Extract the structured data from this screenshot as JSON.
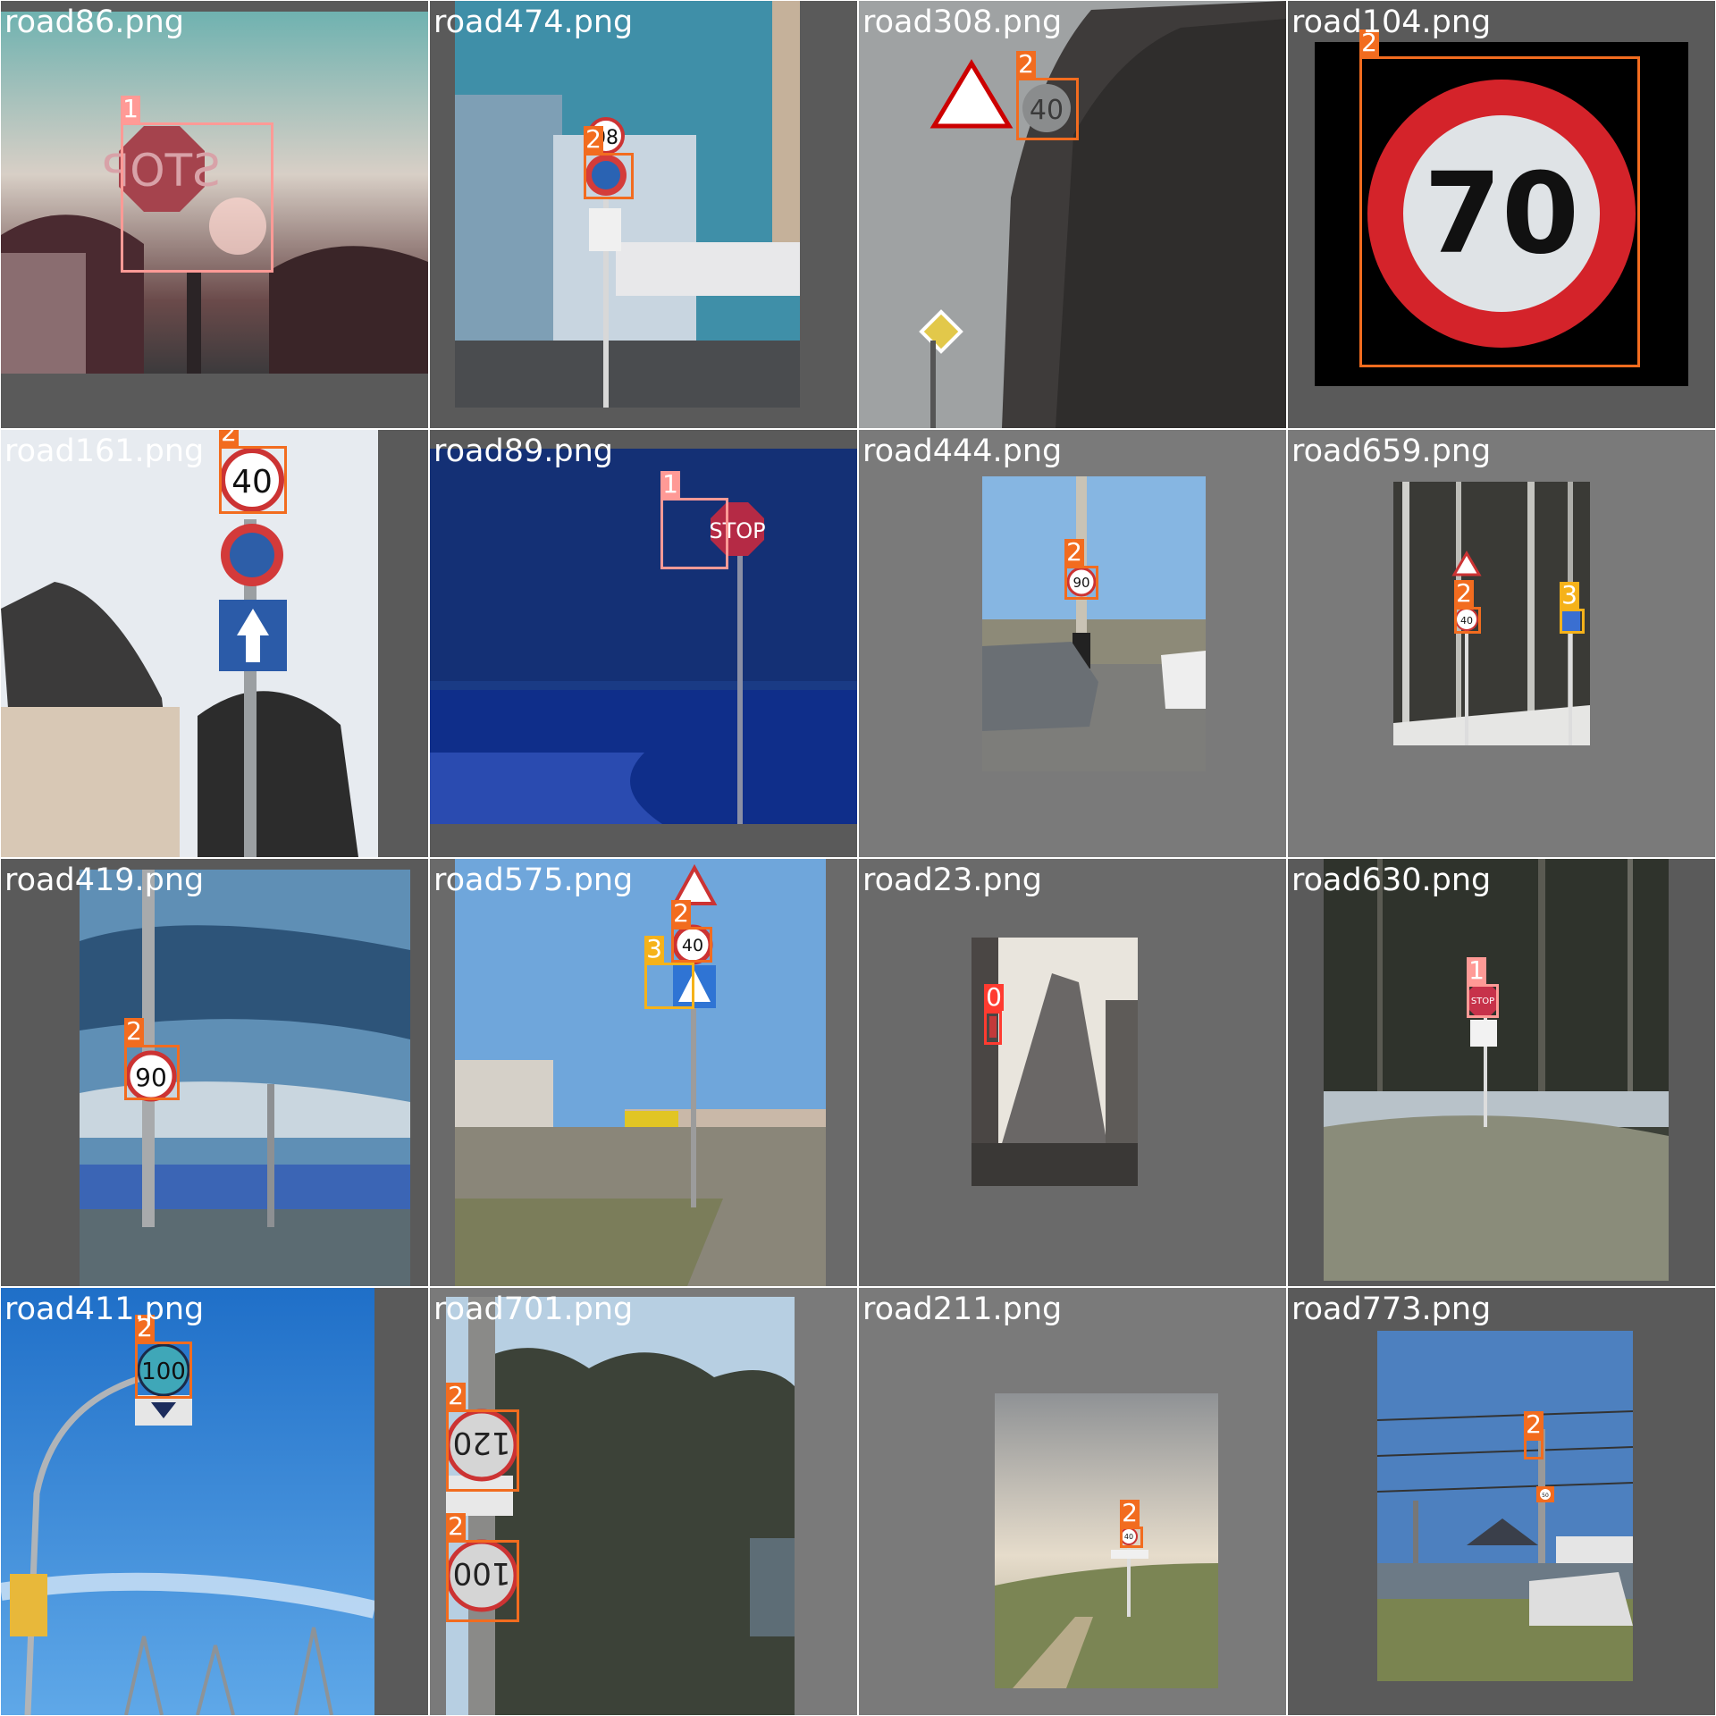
{
  "class_colors": {
    "0": "#ff3b30",
    "1": "#ff9a96",
    "2": "#f26c1f",
    "3": "#f5b21a"
  },
  "tiles": [
    {
      "filename": "road86.png",
      "labels": [
        "1"
      ]
    },
    {
      "filename": "road474.png",
      "labels": [
        "2"
      ]
    },
    {
      "filename": "road308.png",
      "labels": [
        "2"
      ]
    },
    {
      "filename": "road104.png",
      "labels": [
        "2"
      ]
    },
    {
      "filename": "road161.png",
      "labels": [
        "2"
      ]
    },
    {
      "filename": "road89.png",
      "labels": [
        "1"
      ]
    },
    {
      "filename": "road444.png",
      "labels": [
        "2"
      ]
    },
    {
      "filename": "road659.png",
      "labels": [
        "2",
        "3"
      ]
    },
    {
      "filename": "road419.png",
      "labels": [
        "2"
      ]
    },
    {
      "filename": "road575.png",
      "labels": [
        "2",
        "3"
      ]
    },
    {
      "filename": "road23.png",
      "labels": [
        "0"
      ]
    },
    {
      "filename": "road630.png",
      "labels": [
        "1"
      ]
    },
    {
      "filename": "road411.png",
      "labels": [
        "2"
      ]
    },
    {
      "filename": "road701.png",
      "labels": [
        "2",
        "2"
      ]
    },
    {
      "filename": "road211.png",
      "labels": [
        "2"
      ]
    },
    {
      "filename": "road773.png",
      "labels": [
        "2"
      ]
    }
  ],
  "sign_text": {
    "road86": "STOP",
    "road474": "08",
    "road308": "40",
    "road104": "70",
    "road161": "40",
    "road89": "STOP",
    "road444": "90",
    "road659": "40",
    "road419": "90",
    "road575": "40",
    "road630": "STOP",
    "road411": "100",
    "road701_a": "120",
    "road701_b": "100",
    "road211": "40",
    "road773": "50"
  }
}
